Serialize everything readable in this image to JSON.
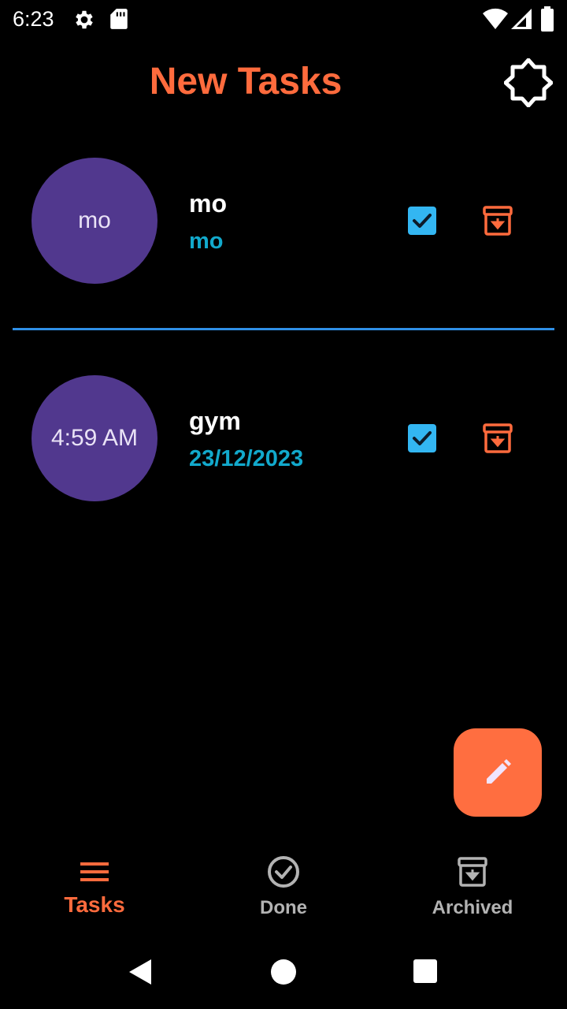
{
  "status_bar": {
    "time": "6:23",
    "icons": [
      "gear-icon",
      "sd-card-icon",
      "wifi-icon",
      "cell-signal-icon",
      "battery-icon"
    ]
  },
  "app_bar": {
    "title": "New Tasks",
    "theme_toggle_icon": "brightness-moon-icon"
  },
  "tasks": [
    {
      "time": "mo",
      "title": "mo",
      "date": "mo",
      "done_icon": "checkbox-checked-icon",
      "archive_icon": "archive-icon"
    },
    {
      "time": "4:59 AM",
      "title": "gym",
      "date": "23/12/2023",
      "done_icon": "checkbox-checked-icon",
      "archive_icon": "archive-icon"
    }
  ],
  "fab": {
    "icon": "edit-pencil-icon"
  },
  "bottom_nav": {
    "items": [
      {
        "label": "Tasks",
        "icon": "menu-lines-icon",
        "active": true
      },
      {
        "label": "Done",
        "icon": "check-circle-icon",
        "active": false
      },
      {
        "label": "Archived",
        "icon": "archive-icon",
        "active": false
      }
    ]
  },
  "colors": {
    "accent": "#ff6b3d",
    "avatar_bg": "#51388e",
    "date_text": "#12a9cc",
    "checkbox": "#33b6f2",
    "divider": "#2f8fe6",
    "background": "#000000"
  }
}
